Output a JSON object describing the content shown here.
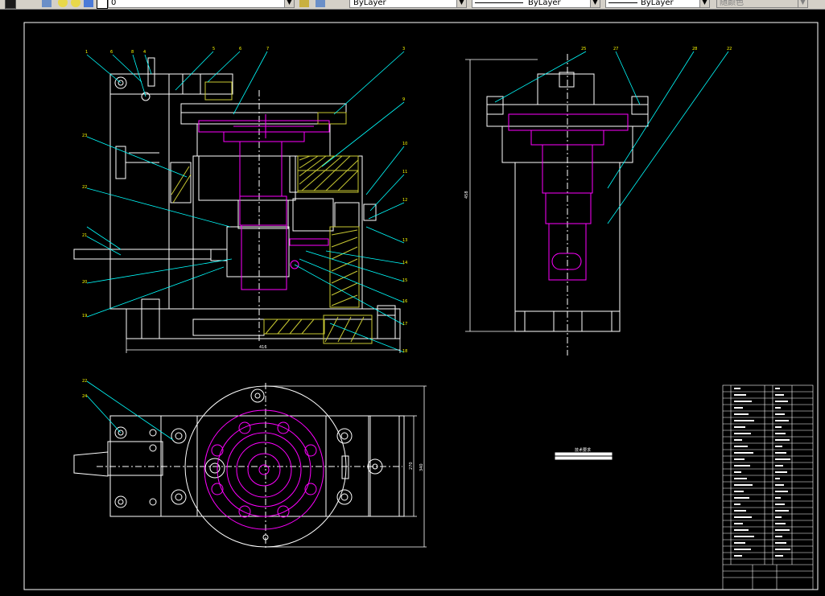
{
  "toolbar": {
    "layer_name": "0",
    "color": "ByLayer",
    "linetype": "ByLayer",
    "lineweight": "ByLayer",
    "plot_style": "随颜色"
  },
  "drawing": {
    "balloons_front": [
      "1",
      "6",
      "8",
      "4",
      "5",
      "6",
      "7",
      "3",
      "9",
      "10",
      "11",
      "12",
      "13",
      "14",
      "15",
      "16",
      "17",
      "18",
      "19",
      "20",
      "21",
      "22",
      "23"
    ],
    "balloons_side": [
      "25",
      "27",
      "28",
      "22"
    ],
    "dim_front_width": "416",
    "dim_side_height": "458",
    "dim_top_height": "340",
    "dim_top_height2": "270",
    "tech_req_title": "技术要求"
  },
  "colors": {
    "background": "#000000",
    "white_lines": "#ffffff",
    "magenta_parts": "#ff00ff",
    "leaders": "#00ffff",
    "hatch": "#c8c832",
    "toolbar": "#d4d0c8"
  }
}
